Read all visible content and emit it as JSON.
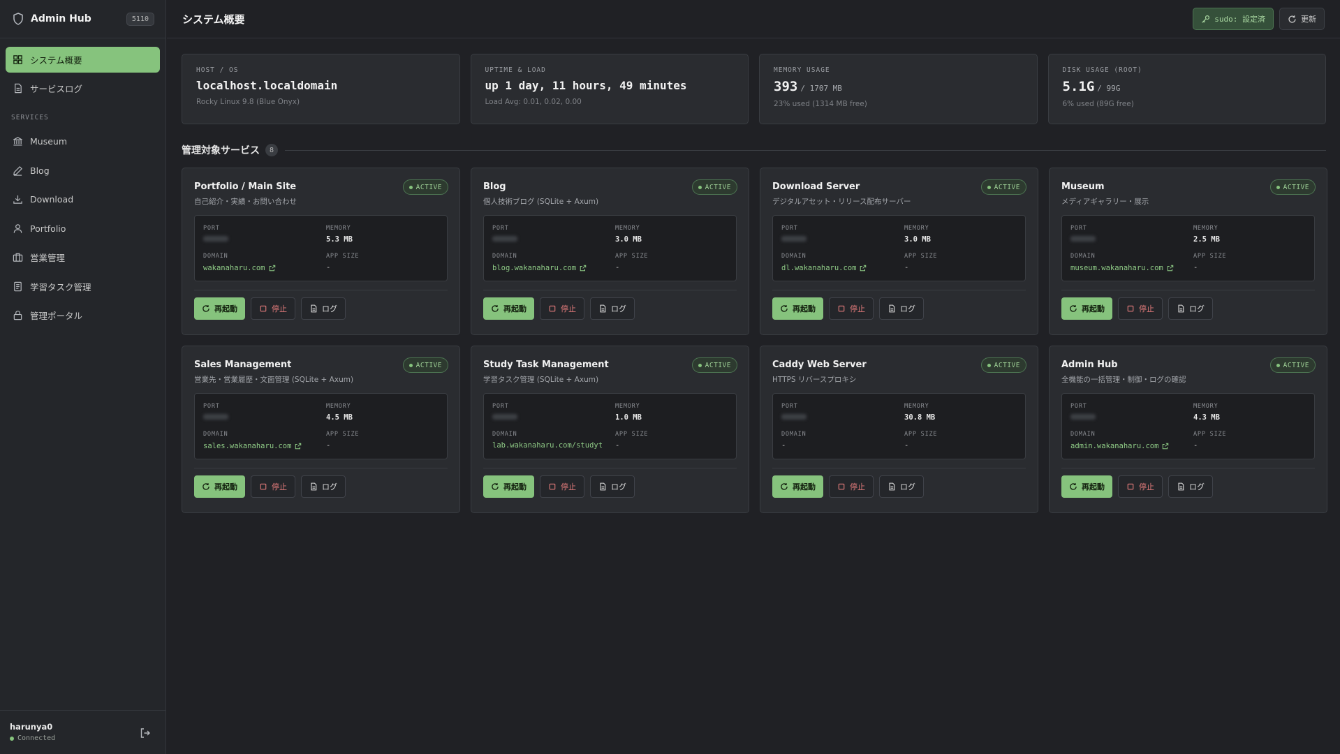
{
  "brand": {
    "title": "Admin Hub",
    "badge": "5110"
  },
  "nav": {
    "items": [
      {
        "label": "システム概要",
        "icon": "grid-icon",
        "active": true
      },
      {
        "label": "サービスログ",
        "icon": "document-icon",
        "active": false
      }
    ],
    "section_label": "SERVICES",
    "services": [
      {
        "label": "Museum",
        "icon": "museum-icon"
      },
      {
        "label": "Blog",
        "icon": "pen-icon"
      },
      {
        "label": "Download",
        "icon": "download-icon"
      },
      {
        "label": "Portfolio",
        "icon": "user-icon"
      },
      {
        "label": "営業管理",
        "icon": "briefcase-icon"
      },
      {
        "label": "学習タスク管理",
        "icon": "document-icon"
      },
      {
        "label": "管理ポータル",
        "icon": "lock-icon"
      }
    ]
  },
  "user": {
    "name": "harunya0",
    "status": "Connected"
  },
  "header": {
    "title": "システム概要",
    "sudo_label": "sudo: 設定済",
    "refresh_label": "更新"
  },
  "stats": {
    "host": {
      "label": "HOST / OS",
      "value": "localhost.localdomain",
      "sub": "Rocky Linux 9.8 (Blue Onyx)"
    },
    "uptime": {
      "label": "UPTIME & LOAD",
      "value": "up 1 day, 11 hours, 49 minutes",
      "sub": "Load Avg: 0.01, 0.02, 0.00"
    },
    "memory": {
      "label": "MEMORY USAGE",
      "value": "393",
      "total": "/ 1707 MB",
      "sub": "23% used (1314 MB free)"
    },
    "disk": {
      "label": "DISK USAGE (ROOT)",
      "value": "5.1G",
      "total": "/ 99G",
      "sub": "6% used (89G free)"
    }
  },
  "services_section": {
    "title": "管理対象サービス",
    "count": "8"
  },
  "labels": {
    "port": "PORT",
    "memory": "MEMORY",
    "domain": "DOMAIN",
    "app_size": "APP SIZE",
    "active": "ACTIVE",
    "restart": "再起動",
    "stop": "停止",
    "log": "ログ"
  },
  "services": [
    {
      "name": "Portfolio / Main Site",
      "desc": "自己紹介・実績・お問い合わせ",
      "memory": "5.3 MB",
      "domain": "wakanaharu.com",
      "domain_link": true,
      "app_size": "-"
    },
    {
      "name": "Blog",
      "desc": "個人技術ブログ (SQLite + Axum)",
      "memory": "3.0 MB",
      "domain": "blog.wakanaharu.com",
      "domain_link": true,
      "app_size": "-"
    },
    {
      "name": "Download Server",
      "desc": "デジタルアセット・リリース配布サーバー",
      "memory": "3.0 MB",
      "domain": "dl.wakanaharu.com",
      "domain_link": true,
      "app_size": "-"
    },
    {
      "name": "Museum",
      "desc": "メディアギャラリー・展示",
      "memory": "2.5 MB",
      "domain": "museum.wakanaharu.com",
      "domain_link": true,
      "app_size": "-"
    },
    {
      "name": "Sales Management",
      "desc": "営業先・営業履歴・文面管理 (SQLite + Axum)",
      "memory": "4.5 MB",
      "domain": "sales.wakanaharu.com",
      "domain_link": true,
      "app_size": "-"
    },
    {
      "name": "Study Task Management",
      "desc": "学習タスク管理 (SQLite + Axum)",
      "memory": "1.0 MB",
      "domain": "lab.wakanaharu.com/studyt",
      "domain_link": false,
      "app_size": "-"
    },
    {
      "name": "Caddy Web Server",
      "desc": "HTTPS リバースプロキシ",
      "memory": "30.8 MB",
      "domain": "-",
      "domain_link": false,
      "app_size": "-"
    },
    {
      "name": "Admin Hub",
      "desc": "全機能の一括管理・制御・ログの確認",
      "memory": "4.3 MB",
      "domain": "admin.wakanaharu.com",
      "domain_link": true,
      "app_size": "-"
    }
  ],
  "colors": {
    "accent": "#86c37d",
    "background": "#202125",
    "card": "#2a2c30",
    "danger": "#e07a7a"
  }
}
